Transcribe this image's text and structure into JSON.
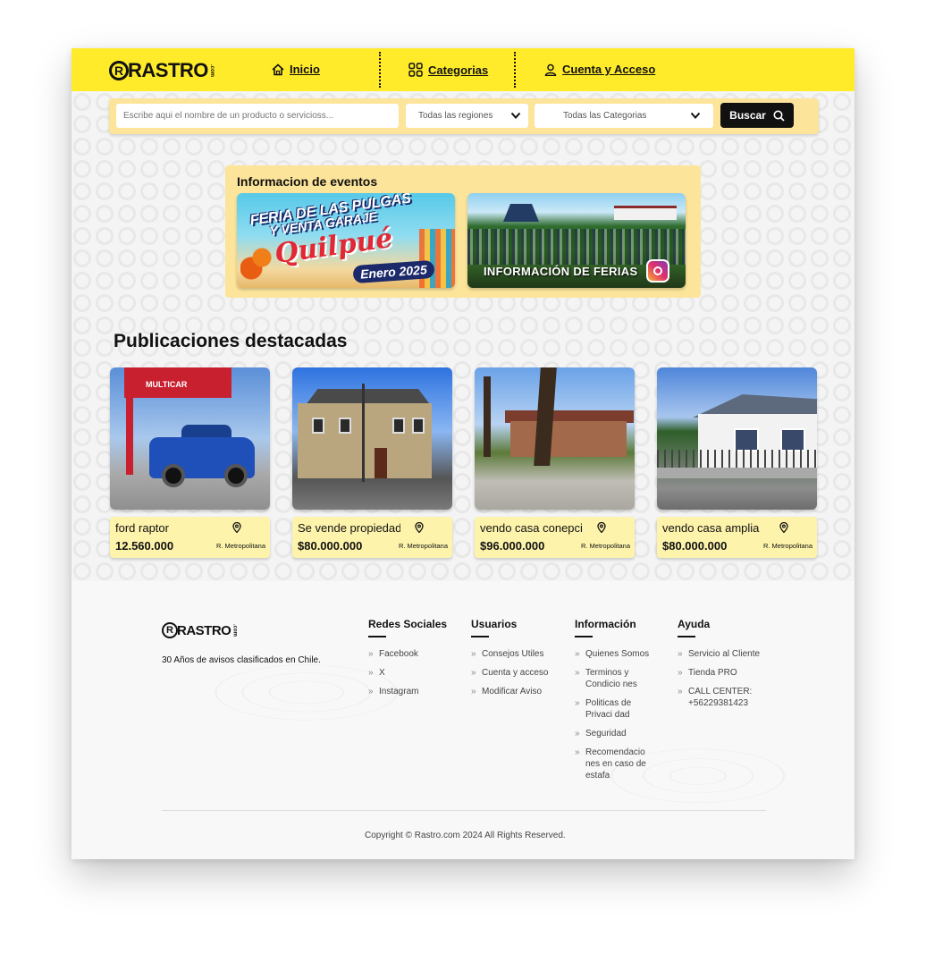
{
  "header": {
    "logo_text": "RASTRO",
    "logo_r": "R",
    "logo_com": ".com",
    "nav": [
      {
        "label": "Inicio"
      },
      {
        "label": "Categorias"
      },
      {
        "label": "Cuenta y Acceso"
      }
    ]
  },
  "search": {
    "placeholder": "Escribe aqui el nombre de un producto o servicioss...",
    "region_selected": "Todas las regiones",
    "category_selected": "Todas las Categorias",
    "button_label": "Buscar"
  },
  "events": {
    "title": "Informacion de eventos",
    "banner1": {
      "line1": "FERIA DE LAS PULGAS",
      "line2": "Y VENTA GARAJE",
      "line3": "Quilpué",
      "line4": "Enero 2025"
    },
    "banner2": {
      "label": "INFORMACIÓN DE FERIAS"
    }
  },
  "featured": {
    "title": "Publicaciones destacadas",
    "items": [
      {
        "name": "ford raptor",
        "price": "12.560.000",
        "region": "R. Metropolitana",
        "sign": "MULTICAR"
      },
      {
        "name": "Se vende propiedad",
        "price": "$80.000.000",
        "region": "R. Metropolitana"
      },
      {
        "name": "vendo casa conepcion",
        "price": "$96.000.000",
        "region": "R. Metropolitana"
      },
      {
        "name": "vendo casa amplia",
        "price": "$80.000.000",
        "region": "R. Metropolitana"
      }
    ]
  },
  "footer": {
    "tagline": "30 Años de avisos clasificados en Chile.",
    "columns": [
      {
        "title": "Redes Sociales",
        "links": [
          "Facebook",
          "X",
          "Instagram"
        ]
      },
      {
        "title": "Usuarios",
        "links": [
          "Consejos Utiles",
          "Cuenta y acceso",
          "Modificar Aviso"
        ]
      },
      {
        "title": "Información",
        "links": [
          "Quienes Somos",
          "Terminos y Condicio nes",
          "Politicas de Privaci dad",
          "Seguridad",
          "Recomendacio nes en caso de estafa"
        ]
      },
      {
        "title": "Ayuda",
        "links": [
          "Servicio al Cliente",
          "Tienda PRO",
          "CALL CENTER: +56229381423"
        ]
      }
    ],
    "copyright": "Copyright © Rastro.com 2024 All Rights Reserved."
  },
  "colors": {
    "brand_yellow": "#ffeb29",
    "panel_yellow": "#fce49a",
    "card_yellow": "#fdf3ab",
    "button_black": "#111111"
  }
}
